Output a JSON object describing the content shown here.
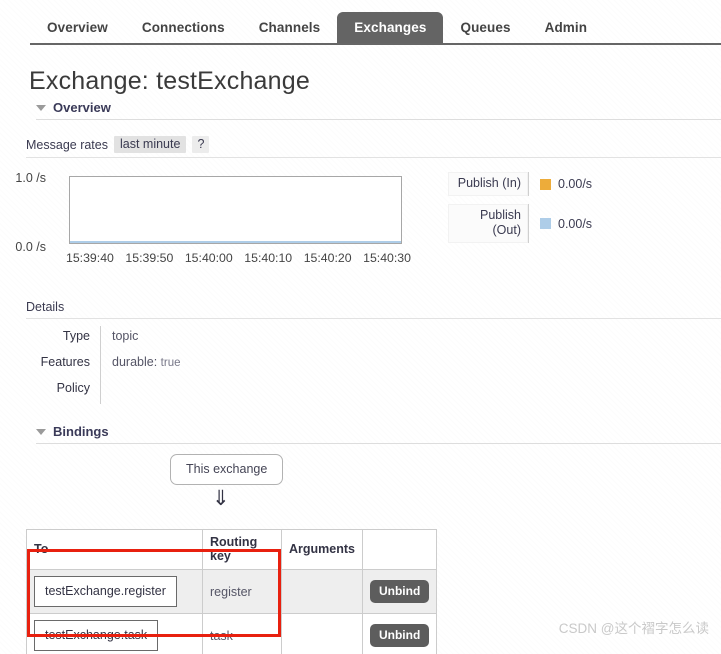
{
  "nav": {
    "tabs": [
      {
        "label": "Overview",
        "active": false
      },
      {
        "label": "Connections",
        "active": false
      },
      {
        "label": "Channels",
        "active": false
      },
      {
        "label": "Exchanges",
        "active": true
      },
      {
        "label": "Queues",
        "active": false
      },
      {
        "label": "Admin",
        "active": false
      }
    ]
  },
  "page": {
    "title": "Exchange: testExchange"
  },
  "overview": {
    "heading": "Overview",
    "rates_label": "Message rates",
    "rates_period": "last minute",
    "help": "?"
  },
  "chart_data": {
    "type": "line",
    "title": "Message rates",
    "xlabel": "",
    "ylabel": "/s",
    "ylim": [
      0.0,
      1.0
    ],
    "ytick_labels": [
      "1.0 /s",
      "0.0 /s"
    ],
    "x": [
      "15:39:40",
      "15:39:50",
      "15:40:00",
      "15:40:10",
      "15:40:20",
      "15:40:30"
    ],
    "grid": false,
    "legend_position": "right",
    "series": [
      {
        "name": "Publish (In)",
        "color": "#edac3a",
        "current_value": "0.00/s",
        "values": [
          0.0,
          0.0,
          0.0,
          0.0,
          0.0,
          0.0
        ]
      },
      {
        "name": "Publish (Out)",
        "color": "#aecde8",
        "current_value": "0.00/s",
        "values": [
          0.0,
          0.0,
          0.0,
          0.0,
          0.0,
          0.0
        ]
      }
    ]
  },
  "details": {
    "heading": "Details",
    "rows": [
      {
        "key": "Type",
        "value": "topic",
        "sub": ""
      },
      {
        "key": "Features",
        "value": "durable:",
        "sub": "true"
      },
      {
        "key": "Policy",
        "value": "",
        "sub": ""
      }
    ]
  },
  "bindings": {
    "heading": "Bindings",
    "source_label": "This exchange",
    "arrow": "⇓",
    "columns": [
      "To",
      "Routing key",
      "Arguments",
      ""
    ],
    "rows": [
      {
        "to": "testExchange.register",
        "routing_key": "register",
        "arguments": "",
        "action": "Unbind"
      },
      {
        "to": "testExchange.task",
        "routing_key": "task",
        "arguments": "",
        "action": "Unbind"
      }
    ]
  },
  "watermark": {
    "text": "CSDN @这个褶字怎么读"
  },
  "colors": {
    "active_tab_bg": "#646464",
    "publish_in": "#edac3a",
    "publish_out": "#aecde8",
    "annotation": "#e8200f"
  }
}
